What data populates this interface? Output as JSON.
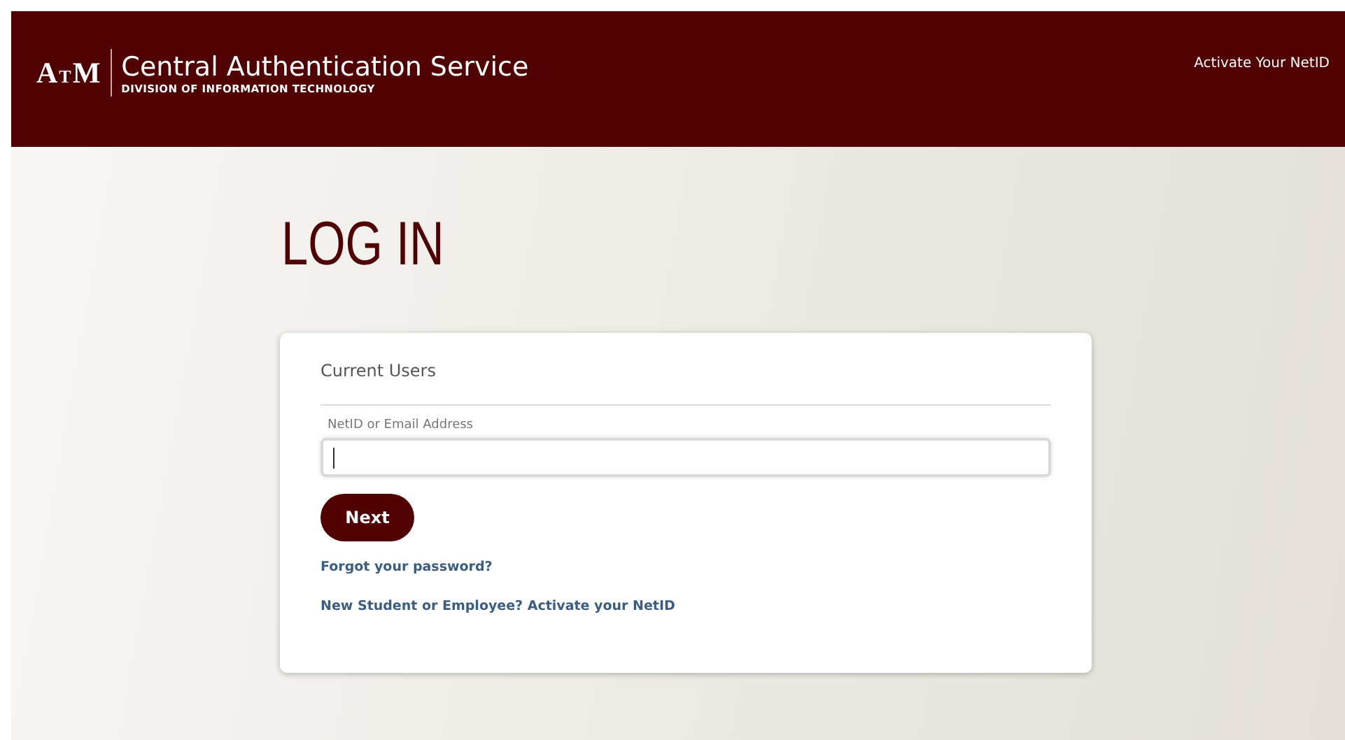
{
  "header": {
    "logo_letters": [
      "A",
      "T",
      "M"
    ],
    "title": "Central Authentication Service",
    "subtitle": "DIVISION OF INFORMATION TECHNOLOGY",
    "nav_link": "Activate Your NetID"
  },
  "heading": "LOG IN",
  "card": {
    "title": "Current Users",
    "field": {
      "label": "NetID or Email Address",
      "focused": true
    },
    "button": "Next",
    "links": [
      "Forgot your password?",
      "New Student or Employee? Activate your NetID"
    ]
  }
}
